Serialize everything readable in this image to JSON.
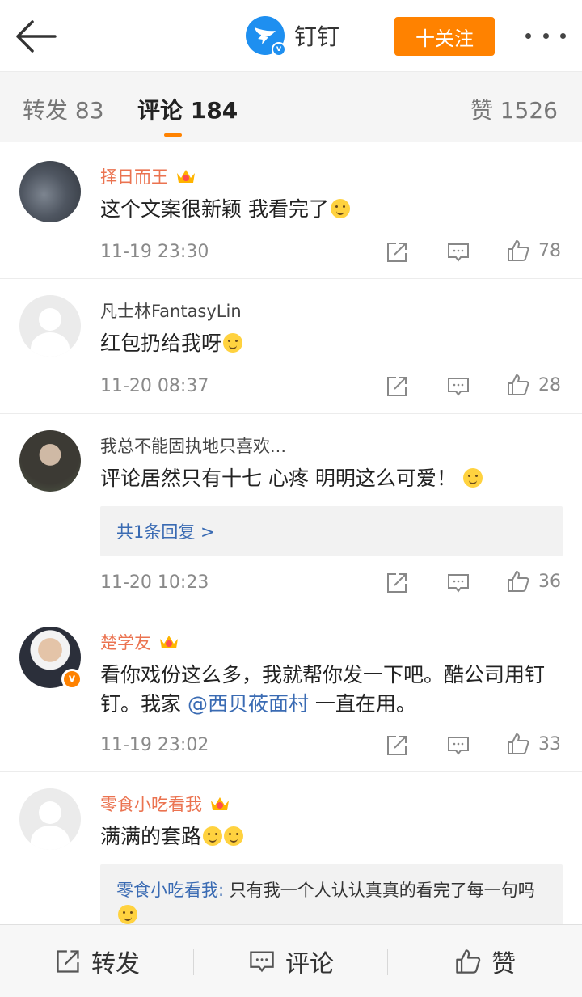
{
  "header": {
    "brand_name": "钉钉",
    "follow_label": "十关注",
    "brand_color": "#1e8ff0",
    "accent_color": "#ff8200"
  },
  "tabs": {
    "repost": "转发 83",
    "comment": "评论 184",
    "like": "赞 1526"
  },
  "comments": [
    {
      "name": "择日而王",
      "text": "这个文案很新颖 我看完了",
      "time": "11-19 23:30",
      "likes": "78"
    },
    {
      "name": "凡士林FantasyLin",
      "text": "红包扔给我呀",
      "time": "11-20 08:37",
      "likes": "28"
    },
    {
      "name": "我总不能固执地只喜欢...",
      "text": "评论居然只有十七 心疼  明明这么可爱！",
      "reply_summary": "共1条回复 >",
      "time": "11-20 10:23",
      "likes": "36"
    },
    {
      "name": "楚学友",
      "text_a": "看你戏份这么多，我就帮你发一下吧。酷公司用钉钉。我家 ",
      "mention": "@西贝莜面村",
      "text_b": " 一直在用。",
      "time": "11-19 23:02",
      "likes": "33"
    },
    {
      "name": "零食小吃看我",
      "text": "满满的套路",
      "reply_name": "零食小吃看我:",
      "reply_text": " 只有我一个人认认真真的看完了每一句吗"
    }
  ],
  "bottom_bar": {
    "repost": "转发",
    "comment": "评论",
    "like": "赞"
  }
}
